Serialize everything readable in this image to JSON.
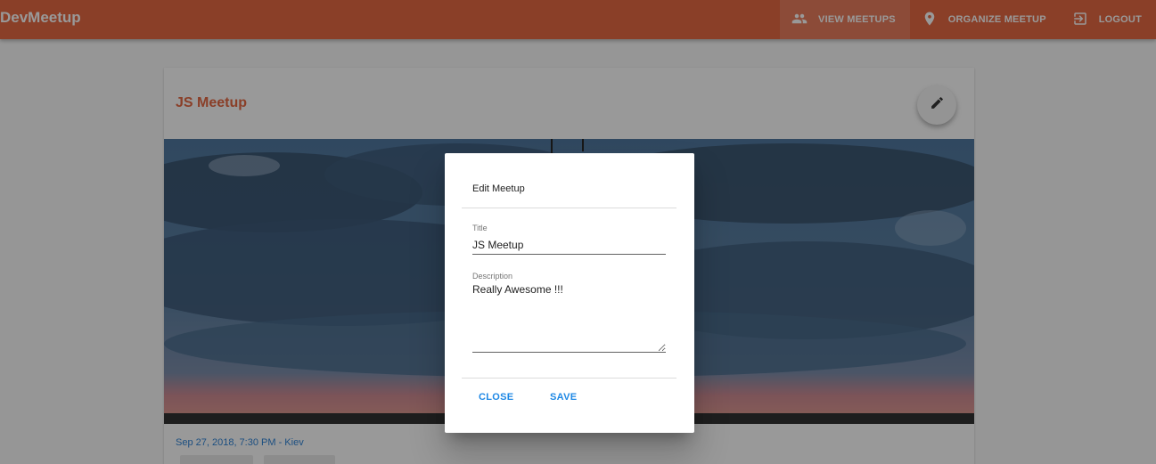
{
  "app": {
    "title": "DevMeetup"
  },
  "nav": {
    "items": [
      {
        "label": "VIEW MEETUPS",
        "icon": "people-icon",
        "active": true
      },
      {
        "label": "ORGANIZE MEETUP",
        "icon": "location-pin-icon",
        "active": false
      },
      {
        "label": "LOGOUT",
        "icon": "exit-icon",
        "active": false
      }
    ]
  },
  "meetup": {
    "title": "JS Meetup",
    "meta": "Sep 27, 2018, 7:30 PM - Kiev"
  },
  "dialog": {
    "title": "Edit Meetup",
    "title_field": {
      "label": "Title",
      "value": "JS Meetup"
    },
    "description_field": {
      "label": "Description",
      "value": "Really Awesome !!!"
    },
    "close_label": "CLOSE",
    "save_label": "SAVE"
  },
  "colors": {
    "primary": "#e4592f",
    "accent": "#1e88e5"
  }
}
